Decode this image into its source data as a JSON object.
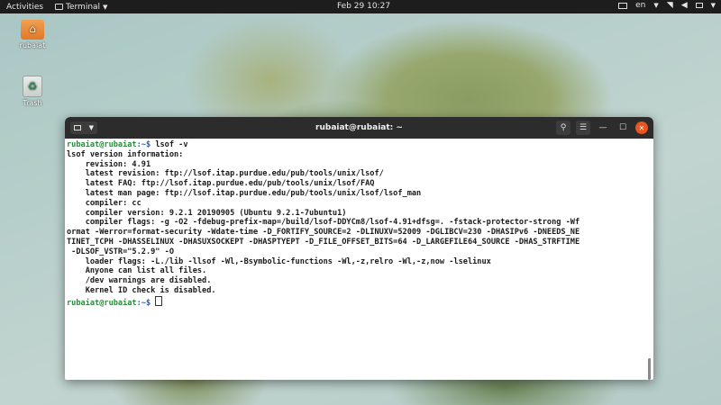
{
  "topbar": {
    "activities": "Activities",
    "app_name": "Terminal",
    "clock": "Feb 29  10:27",
    "language": "en"
  },
  "desktop": {
    "icons": [
      {
        "label": "rubaiat",
        "icon": "home-folder-icon"
      },
      {
        "label": "Trash",
        "icon": "trash-icon"
      }
    ]
  },
  "terminal": {
    "title": "rubaiat@rubaiat: ~",
    "prompt_user": "rubaiat@rubaiat",
    "prompt_path": ":~$",
    "command": " lsof -v",
    "lines": [
      "lsof version information:",
      "    revision: 4.91",
      "    latest revision: ftp://lsof.itap.purdue.edu/pub/tools/unix/lsof/",
      "    latest FAQ: ftp://lsof.itap.purdue.edu/pub/tools/unix/lsof/FAQ",
      "    latest man page: ftp://lsof.itap.purdue.edu/pub/tools/unix/lsof/lsof_man",
      "    compiler: cc",
      "    compiler version: 9.2.1 20190905 (Ubuntu 9.2.1-7ubuntu1)",
      "    compiler flags: -g -O2 -fdebug-prefix-map=/build/lsof-DDYCm8/lsof-4.91+dfsg=. -fstack-protector-strong -Wf",
      "ormat -Werror=format-security -Wdate-time -D_FORTIFY_SOURCE=2 -DLINUXV=52009 -DGLIBCV=230 -DHASIPv6 -DNEEDS_NE",
      "TINET_TCPH -DHASSELINUX -DHASUXSOCKEPT -DHASPTYEPT -D_FILE_OFFSET_BITS=64 -D_LARGEFILE64_SOURCE -DHAS_STRFTIME",
      " -DLSOF_VSTR=\"5.2.9\" -O",
      "    loader flags: -L./lib -llsof -Wl,-Bsymbolic-functions -Wl,-z,relro -Wl,-z,now -lselinux",
      "    Anyone can list all files.",
      "    /dev warnings are disabled.",
      "    Kernel ID check is disabled."
    ]
  }
}
